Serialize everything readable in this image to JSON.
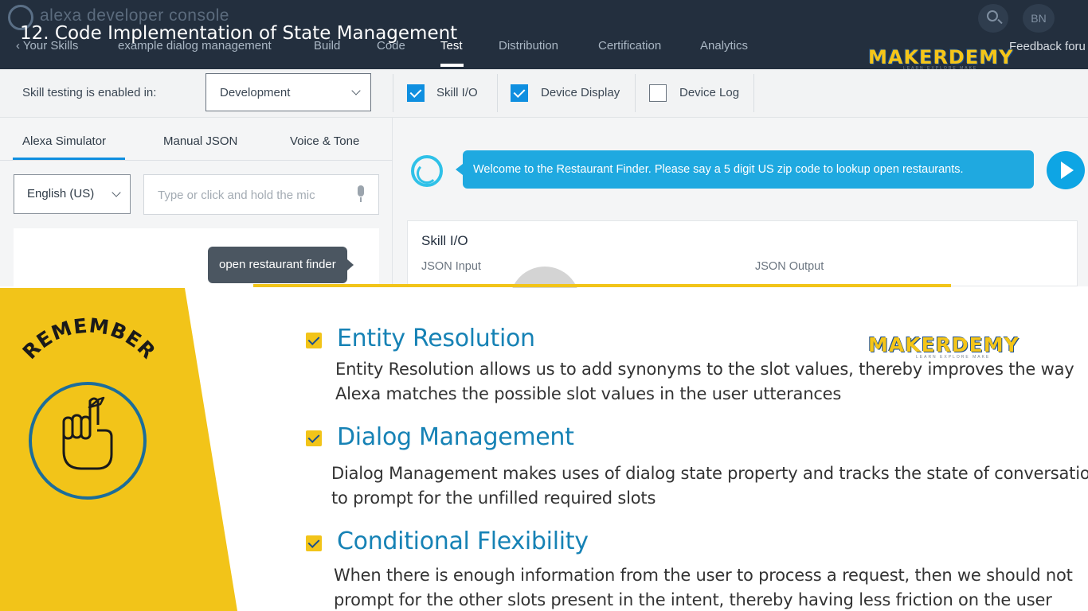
{
  "video": {
    "title": "12. Code Implementation of State Management"
  },
  "console": {
    "title": "alexa developer console",
    "nav": {
      "back": "Your Skills",
      "skill_name": "example dialog management",
      "tabs": [
        "Build",
        "Code",
        "Test",
        "Distribution",
        "Certification",
        "Analytics"
      ],
      "active_tab": "Test",
      "feedback": "Feedback foru"
    },
    "user_initials": "BN",
    "toolbar": {
      "testing_label": "Skill testing is enabled in:",
      "environment": "Development",
      "checkboxes": [
        {
          "label": "Skill I/O",
          "checked": true
        },
        {
          "label": "Device Display",
          "checked": true
        },
        {
          "label": "Device Log",
          "checked": false
        }
      ]
    },
    "simulator": {
      "tabs": [
        "Alexa Simulator",
        "Manual JSON",
        "Voice & Tone"
      ],
      "active_tab": "Alexa Simulator",
      "language": "English (US)",
      "input_placeholder": "Type or click and hold the mic",
      "user_message": "open restaurant finder"
    },
    "alexa_response": "Welcome to the Restaurant Finder. Please say a 5 digit US zip code to lookup open restaurants.",
    "skill_io": {
      "title": "Skill I/O",
      "input_label": "JSON Input",
      "output_label": "JSON Output"
    }
  },
  "brand": {
    "name": "MAKERDEMY",
    "tagline": "LEARN EXPLORE MAKE",
    "color": "#f5c518",
    "outline": "#1b4e8f"
  },
  "slide": {
    "badge": "REMEMBER",
    "accent": "#f2c419",
    "heading_color": "#1682b5",
    "items": [
      {
        "title": "Entity Resolution",
        "lines": [
          "Entity Resolution allows us to add synonyms to the slot values, thereby improves the way",
          "Alexa matches the possible slot values in the user utterances"
        ]
      },
      {
        "title": "Dialog Management",
        "lines": [
          "Dialog Management makes uses of dialog state property and tracks the state of conversation",
          "to prompt for the unfilled required slots"
        ]
      },
      {
        "title": "Conditional Flexibility",
        "lines": [
          "When there is enough information from the user to process a request, then we should not",
          "prompt for the other slots present in the intent, thereby having less friction on the user"
        ]
      }
    ]
  }
}
